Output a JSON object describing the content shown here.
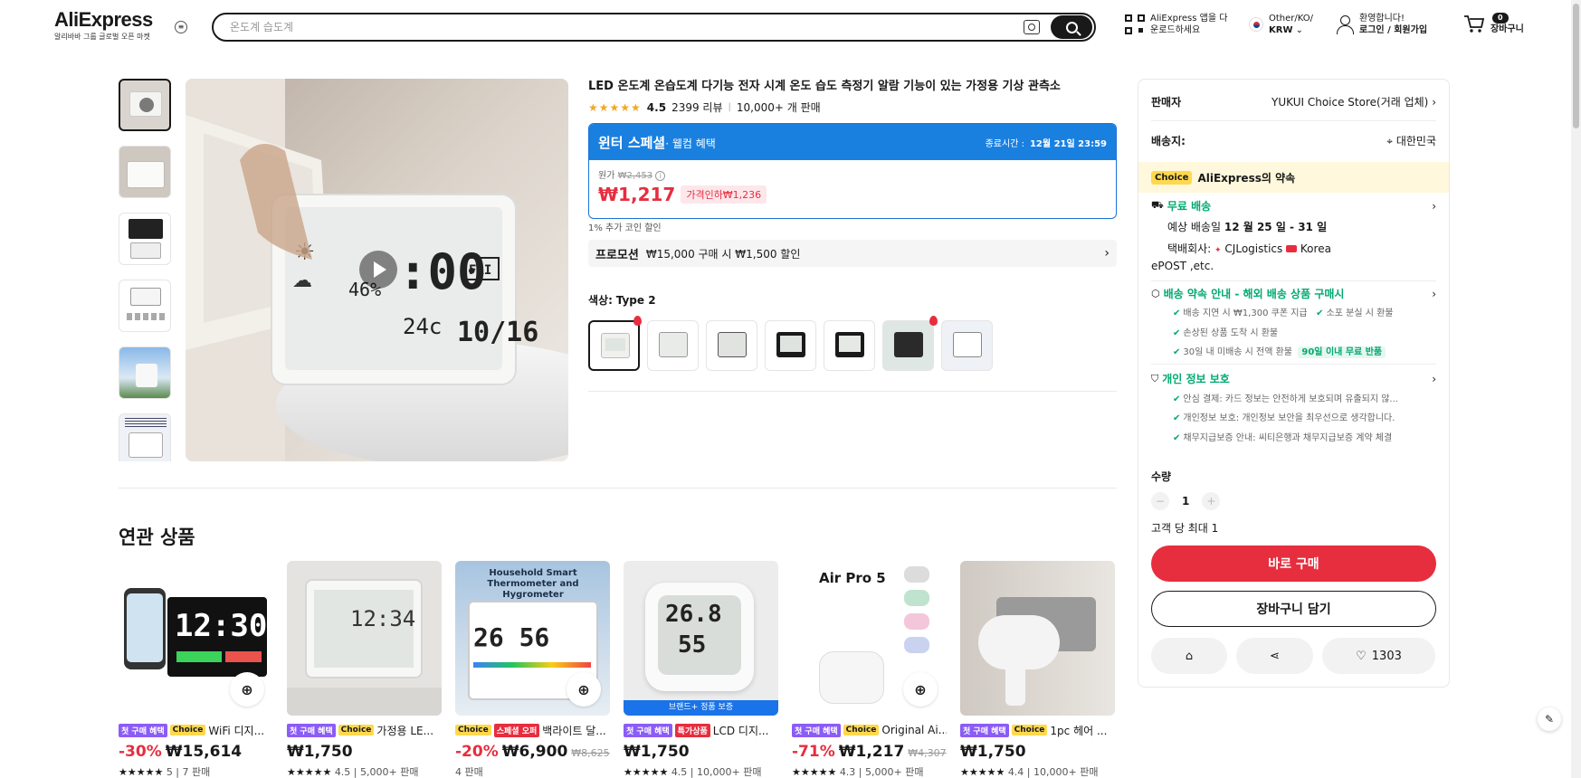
{
  "header": {
    "logo": "AliExpress",
    "logo_sub": "알리바바 그룹 글로벌 오픈 마켓",
    "search_placeholder": "온도계 습도계",
    "app_line1": "AliExpress 앱을 다",
    "app_line2": "운로드하세요",
    "region_line1": "Other/KO/",
    "region_line2": "KRW",
    "user_line1": "환영합니다!",
    "user_line2": "로그인 / 회원가입",
    "cart_count": "0",
    "cart_label": "장바구니"
  },
  "product": {
    "title": "LED 온도계 온습도계 다기능 전자 시계 온도 습도 측정기 알람 기능이 있는 가정용 기상 관측소",
    "stars": "★★★★★",
    "rating": "4.5",
    "reviews": "2399 리뷰",
    "sold": "10,000+ 개 판매",
    "promo_title": "윈터 스페셜",
    "promo_subtitle": "· 웰컴 혜택",
    "promo_end_label": "종료시간 :",
    "promo_end_time": "12월 21일 23:59",
    "orig_label": "원가",
    "orig_price": "₩2,453",
    "price": "₩1,217",
    "price_tag": "가격인하₩1,236",
    "coin": "1% 추가 코인 할인",
    "promotion_label": "프로모션",
    "promotion_text": "₩15,000 구매 시 ₩1,500 할인",
    "color_label": "색상:",
    "color_value": "Type 2"
  },
  "seller": {
    "label": "판매자",
    "name": "YUKUI Choice Store(거래 업체)",
    "ship_label": "배송지:",
    "ship_to": "대한민국",
    "choice_tag": "Choice",
    "choice_text": "AliExpress의 약속",
    "free_ship": "무료 배송",
    "eta_prefix": "예상 배송일",
    "eta": "12 월 25 일 - 31 일",
    "carrier_prefix": "택배회사:",
    "carrier_line1": "CJLogistics",
    "carrier_line1b": "Korea",
    "carrier_line2": "ePOST ,etc.",
    "promise_title": "배송 약속 안내 - 해외 배송 상품 구매시",
    "promise_items": [
      "배송 지연 시 ₩1,300 쿠폰 지급",
      "소포 분실 시 환불",
      "손상된 상품 도착 시 환불",
      "30일 내 미배송 시 전액 환불"
    ],
    "promise_tag": "90일 이내 무료 반품",
    "privacy_title": "개인 정보 보호",
    "privacy_items": [
      "안심 결제: 카드 정보는 안전하게 보호되며 유출되지 않...",
      "개인정보 보호: 개인정보 보안을 최우선으로 생각합니다.",
      "채무지급보증 안내: 씨티은행과 채무지급보증 계약 체결"
    ],
    "qty_label": "수량",
    "qty_value": "1",
    "qty_limit": "고객 당 최대 1",
    "buy_now": "바로 구매",
    "add_cart": "장바구니 담기",
    "wishlist_count": "1303"
  },
  "related": {
    "title": "연관 상품",
    "items": [
      {
        "b1": "첫 구매 혜택",
        "b2": "Choice",
        "name": "WiFi 디지...",
        "disc": "-30%",
        "price": "₩15,614",
        "orig": "",
        "stars": "★★★★★",
        "rating": "5",
        "sold": "7 판매"
      },
      {
        "b1": "첫 구매 혜택",
        "b2": "Choice",
        "name": "가정용 LE...",
        "disc": "",
        "price": "₩1,750",
        "orig": "",
        "stars": "★★★★★",
        "rating": "4.5",
        "sold": "5,000+ 판매"
      },
      {
        "b1": "Choice",
        "b2": "스페셜 오퍼",
        "name": "백라이트 달...",
        "disc": "-20%",
        "price": "₩6,900",
        "orig": "₩8,625",
        "stars": "",
        "rating": "",
        "sold": "4 판매"
      },
      {
        "b1": "첫 구매 혜택",
        "b2": "특가상품",
        "name": "LCD 디지...",
        "disc": "",
        "price": "₩1,750",
        "orig": "",
        "stars": "★★★★★",
        "rating": "4.5",
        "sold": "10,000+ 판매"
      },
      {
        "b1": "첫 구매 혜택",
        "b2": "Choice",
        "name": "Original Ai...",
        "disc": "-71%",
        "price": "₩1,217",
        "orig": "₩4,307",
        "stars": "★★★★★",
        "rating": "4.3",
        "sold": "5,000+ 판매"
      },
      {
        "b1": "첫 구매 혜택",
        "b2": "Choice",
        "name": "1pc 헤어 ...",
        "disc": "",
        "price": "₩1,750",
        "orig": "",
        "stars": "★★★★★",
        "rating": "4.4",
        "sold": "10,000+ 판매"
      }
    ],
    "img_text": {
      "clock_time": "12:30",
      "household": "Household Smart Thermometer and Hygrometer",
      "temp": "26.8",
      "brand_band": "브랜드+ 정품 보증",
      "airpro": "Air Pro 5"
    }
  }
}
